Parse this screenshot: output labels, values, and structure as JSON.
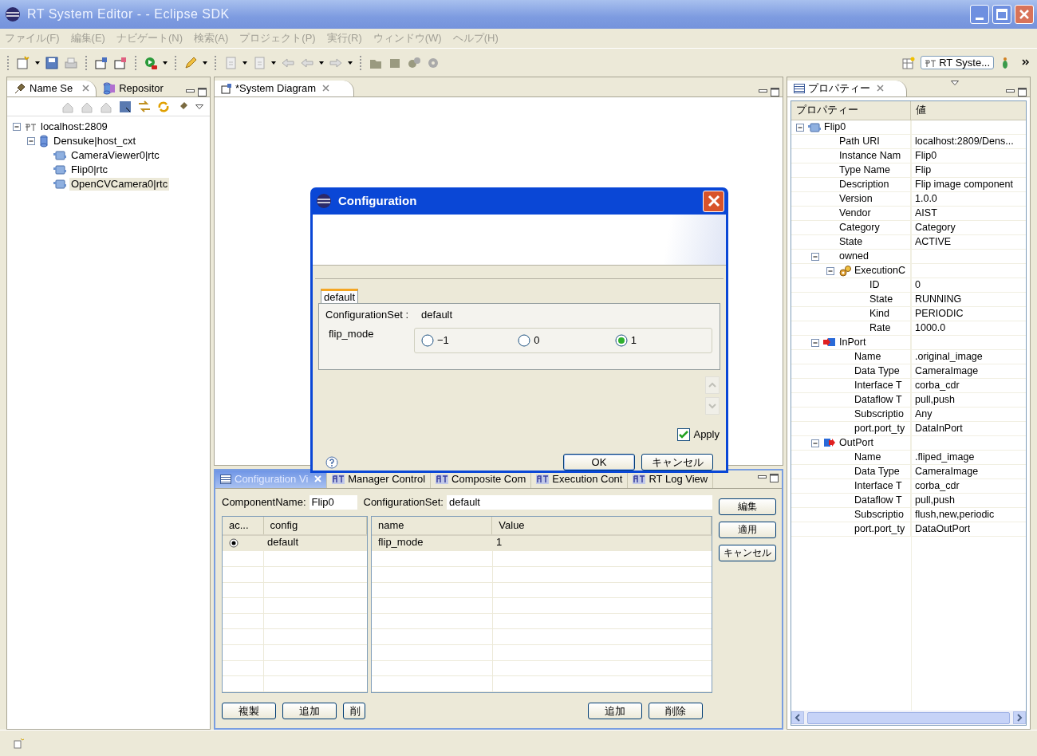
{
  "window": {
    "title": "RT System Editor -  - Eclipse SDK"
  },
  "menu": [
    "ファイル(F)",
    "編集(E)",
    "ナビゲート(N)",
    "検索(A)",
    "プロジェクト(P)",
    "実行(R)",
    "ウィンドウ(W)",
    "ヘルプ(H)"
  ],
  "perspective": {
    "label": "RT Syste..."
  },
  "name_service": {
    "tabs": [
      {
        "label": "Name Se",
        "selected": true
      },
      {
        "label": "Repositor",
        "selected": false
      }
    ],
    "tree": [
      {
        "kind": "host",
        "label": "localhost:2809",
        "expanded": true,
        "selected": false,
        "children": [
          {
            "kind": "context",
            "label": "Densuke|host_cxt",
            "expanded": true,
            "selected": false,
            "children": [
              {
                "kind": "component",
                "label": "CameraViewer0|rtc",
                "selected": false
              },
              {
                "kind": "component",
                "label": "Flip0|rtc",
                "selected": false
              },
              {
                "kind": "component",
                "label": "OpenCVCamera0|rtc",
                "selected": true
              }
            ]
          }
        ]
      }
    ]
  },
  "editor": {
    "tabs": [
      {
        "label": "*System Diagram",
        "selected": true
      }
    ]
  },
  "properties": {
    "tab": "プロパティー",
    "columns": [
      "プロパティー",
      "値"
    ],
    "rows": [
      {
        "kind": "component",
        "name": "Flip0",
        "expanded": true,
        "children": [
          {
            "name": "Path URI",
            "value": "localhost:2809/Dens..."
          },
          {
            "name": "Instance Nam",
            "value": "Flip0"
          },
          {
            "name": "Type Name",
            "value": "Flip"
          },
          {
            "name": "Description",
            "value": "Flip image component"
          },
          {
            "name": "Version",
            "value": "1.0.0"
          },
          {
            "name": "Vendor",
            "value": "AIST"
          },
          {
            "name": "Category",
            "value": "Category"
          },
          {
            "name": "State",
            "value": "ACTIVE"
          },
          {
            "name": "owned",
            "expanded": true,
            "children": [
              {
                "kind": "execution",
                "name": "ExecutionC",
                "expanded": true,
                "children": [
                  {
                    "name": "ID",
                    "value": "0"
                  },
                  {
                    "name": "State",
                    "value": "RUNNING"
                  },
                  {
                    "name": "Kind",
                    "value": "PERIODIC"
                  },
                  {
                    "name": "Rate",
                    "value": "1000.0"
                  }
                ]
              }
            ]
          },
          {
            "kind": "inport",
            "name": "InPort",
            "expanded": true,
            "children": [
              {
                "name": "Name",
                "value": ".original_image"
              },
              {
                "name": "Data Type",
                "value": "CameraImage"
              },
              {
                "name": "Interface T",
                "value": "corba_cdr"
              },
              {
                "name": "Dataflow T",
                "value": "pull,push"
              },
              {
                "name": "Subscriptio",
                "value": "Any"
              },
              {
                "name": "port.port_ty",
                "value": "DataInPort"
              }
            ]
          },
          {
            "kind": "outport",
            "name": "OutPort",
            "expanded": true,
            "children": [
              {
                "name": "Name",
                "value": ".fliped_image"
              },
              {
                "name": "Data Type",
                "value": "CameraImage"
              },
              {
                "name": "Interface T",
                "value": "corba_cdr"
              },
              {
                "name": "Dataflow T",
                "value": "pull,push"
              },
              {
                "name": "Subscriptio",
                "value": "flush,new,periodic"
              },
              {
                "name": "port.port_ty",
                "value": "DataOutPort"
              }
            ]
          }
        ]
      }
    ]
  },
  "config_view": {
    "tabs": [
      {
        "label": "Configuration Vi",
        "selected": true
      },
      {
        "label": "Manager Control",
        "selected": false
      },
      {
        "label": "Composite Com",
        "selected": false
      },
      {
        "label": "Execution Cont",
        "selected": false
      },
      {
        "label": "RT  Log View",
        "selected": false
      }
    ],
    "component_name_label": "ComponentName:",
    "component_name": "Flip0",
    "config_set_label": "ConfigurationSet:",
    "config_set": "default",
    "sets_table": {
      "columns": [
        "ac...",
        "config"
      ],
      "rows": [
        {
          "active": true,
          "name": "default",
          "selected": true
        }
      ]
    },
    "params_table": {
      "columns": [
        "name",
        "Value"
      ],
      "rows": [
        {
          "name": "flip_mode",
          "value": "1",
          "selected": true
        }
      ]
    },
    "side_buttons": [
      "編集",
      "適用",
      "キャンセル"
    ],
    "set_buttons": [
      "複製",
      "追加",
      "削"
    ],
    "param_buttons": [
      "追加",
      "削除"
    ]
  },
  "dialog": {
    "title": "Configuration",
    "tabs": [
      {
        "label": "default",
        "selected": true
      }
    ],
    "set_label": "ConfigurationSet :",
    "set_name": "default",
    "params": [
      {
        "name": "flip_mode",
        "options": [
          {
            "label": "−1",
            "selected": false
          },
          {
            "label": "0",
            "selected": false
          },
          {
            "label": "1",
            "selected": true
          }
        ]
      }
    ],
    "apply": {
      "label": "Apply",
      "checked": true
    },
    "buttons": [
      "OK",
      "キャンセル"
    ]
  }
}
